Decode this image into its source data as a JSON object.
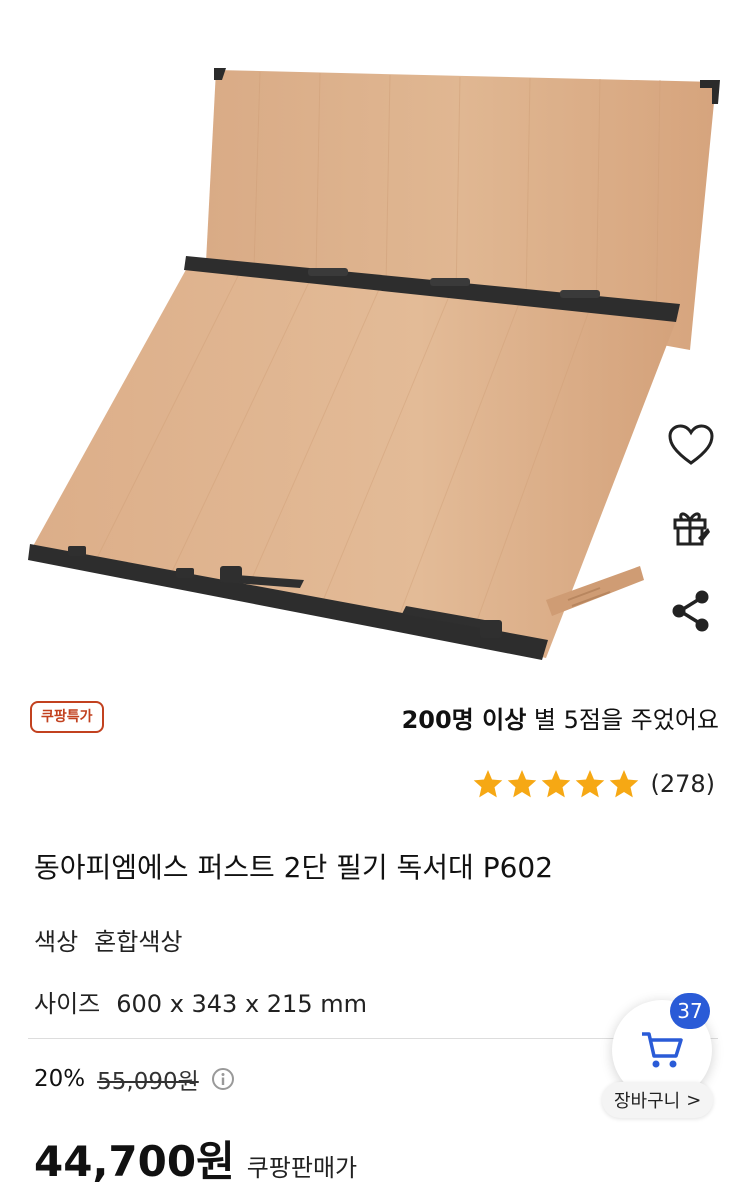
{
  "product": {
    "badge": "쿠팡특가",
    "review_prefix": "200명 이상",
    "review_suffix": " 별 5점을 주었어요",
    "rating": 5,
    "review_count": "(278)",
    "title": "동아피엠에스 퍼스트 2단 필기 독서대 P602",
    "options": [
      {
        "key": "색상",
        "value": "혼합색상"
      },
      {
        "key": "사이즈",
        "value": "600 x 343 x 215 mm"
      }
    ],
    "discount_percent": "20%",
    "original_price": "55,090원",
    "price": "44,700원",
    "price_label": "쿠팡판매가"
  },
  "side_actions": {
    "icons": [
      "heart-icon",
      "gift-icon",
      "share-icon"
    ]
  },
  "cart": {
    "count": "37",
    "label": "장바구니",
    "chevron": ">"
  },
  "colors": {
    "badge": "#c2411f",
    "star": "#f6a814",
    "cart_badge": "#2a5bd7",
    "wood": "#d9aa83"
  }
}
